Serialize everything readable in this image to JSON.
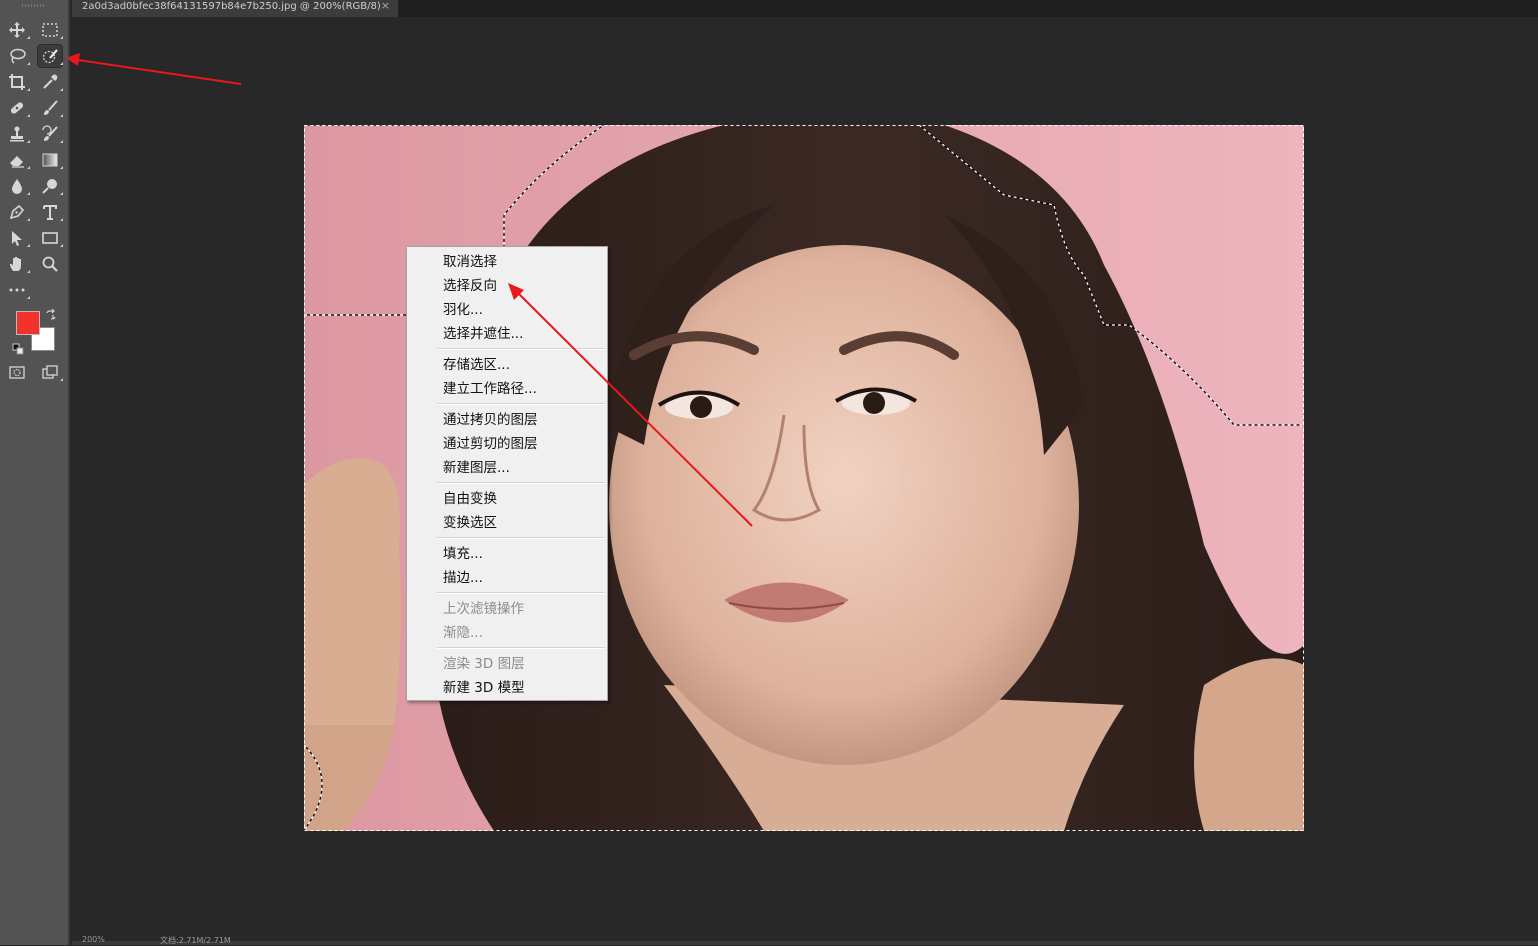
{
  "document": {
    "tab_title": "2a0d3ad0bfec38f64131597b84e7b250.jpg @ 200%(RGB/8)",
    "close_glyph": "×"
  },
  "toolbar": {
    "tools": [
      {
        "name": "move-tool",
        "icon": "move-icon"
      },
      {
        "name": "rect-marquee-tool",
        "icon": "rect-marquee-icon"
      },
      {
        "name": "lasso-tool",
        "icon": "lasso-icon"
      },
      {
        "name": "quick-selection-tool",
        "icon": "quick-selection-icon",
        "active": true
      },
      {
        "name": "crop-tool",
        "icon": "crop-icon"
      },
      {
        "name": "eyedropper-tool",
        "icon": "eyedropper-icon"
      },
      {
        "name": "healing-brush-tool",
        "icon": "bandage-icon"
      },
      {
        "name": "brush-tool",
        "icon": "brush-icon"
      },
      {
        "name": "clone-stamp-tool",
        "icon": "stamp-icon"
      },
      {
        "name": "history-brush-tool",
        "icon": "history-brush-icon"
      },
      {
        "name": "eraser-tool",
        "icon": "eraser-icon"
      },
      {
        "name": "gradient-tool",
        "icon": "gradient-icon"
      },
      {
        "name": "blur-tool",
        "icon": "drop-icon"
      },
      {
        "name": "dodge-tool",
        "icon": "dodge-icon"
      },
      {
        "name": "pen-tool",
        "icon": "pen-icon"
      },
      {
        "name": "type-tool",
        "icon": "type-icon"
      },
      {
        "name": "path-selection-tool",
        "icon": "arrow-icon"
      },
      {
        "name": "rectangle-tool",
        "icon": "rectangle-icon"
      },
      {
        "name": "hand-tool",
        "icon": "hand-icon"
      },
      {
        "name": "zoom-tool",
        "icon": "zoom-icon"
      },
      {
        "name": "more-tools",
        "icon": "ellipsis-icon"
      }
    ],
    "foreground_color": "#f2312a",
    "background_color": "#ffffff"
  },
  "context_menu": {
    "items": [
      {
        "label": "取消选择",
        "enabled": true
      },
      {
        "label": "选择反向",
        "enabled": true
      },
      {
        "label": "羽化...",
        "enabled": true
      },
      {
        "label": "选择并遮住...",
        "enabled": true
      },
      {
        "label": "存储选区...",
        "enabled": true
      },
      {
        "label": "建立工作路径...",
        "enabled": true
      },
      {
        "label": "通过拷贝的图层",
        "enabled": true
      },
      {
        "label": "通过剪切的图层",
        "enabled": true
      },
      {
        "label": "新建图层...",
        "enabled": true
      },
      {
        "label": "自由变换",
        "enabled": true
      },
      {
        "label": "变换选区",
        "enabled": true
      },
      {
        "label": "填充...",
        "enabled": true
      },
      {
        "label": "描边...",
        "enabled": true
      },
      {
        "label": "上次滤镜操作",
        "enabled": false
      },
      {
        "label": "渐隐...",
        "enabled": false
      },
      {
        "label": "渲染 3D 图层",
        "enabled": false
      },
      {
        "label": "新建 3D 模型",
        "enabled": true
      }
    ]
  },
  "statusbar": {
    "zoom": "200%",
    "doc_info": "文档:2.71M/2.71M"
  },
  "annotation_color": "#e8191c"
}
